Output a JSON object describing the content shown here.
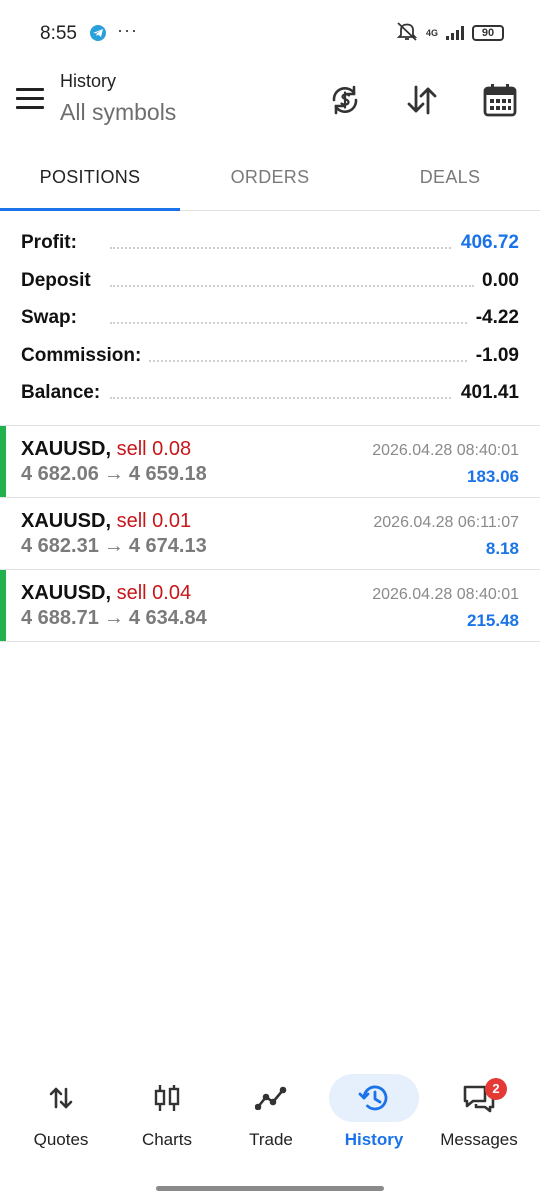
{
  "status_bar": {
    "time": "8:55",
    "dots": "···",
    "network": "4G",
    "battery": "90",
    "icons": [
      "telegram-icon",
      "mute-icon",
      "signal-icon",
      "battery-icon"
    ]
  },
  "header": {
    "title": "History",
    "subtitle": "All symbols",
    "icons": [
      "menu-icon",
      "currency-exchange-icon",
      "sort-icon",
      "calendar-icon"
    ]
  },
  "tabs": [
    {
      "label": "POSITIONS",
      "active": true
    },
    {
      "label": "ORDERS",
      "active": false
    },
    {
      "label": "DEALS",
      "active": false
    }
  ],
  "summary": [
    {
      "label": "Profit:",
      "value": "406.72",
      "color": "#1a73e8"
    },
    {
      "label": "Deposit",
      "value": "0.00",
      "color": "#111111"
    },
    {
      "label": "Swap:",
      "value": "-4.22",
      "color": "#111111"
    },
    {
      "label": "Commission:",
      "value": "-1.09",
      "color": "#111111"
    },
    {
      "label": "Balance:",
      "value": "401.41",
      "color": "#111111"
    }
  ],
  "trades": [
    {
      "symbol": "XAUUSD,",
      "side": "sell 0.08",
      "open": "4 682.06",
      "arrow": "→",
      "close": "4 659.18",
      "time": "2026.04.28 08:40:01",
      "profit": "183.06",
      "marker": true
    },
    {
      "symbol": "XAUUSD,",
      "side": "sell 0.01",
      "open": "4 682.31",
      "arrow": "→",
      "close": "4 674.13",
      "time": "2026.04.28 06:11:07",
      "profit": "8.18",
      "marker": false
    },
    {
      "symbol": "XAUUSD,",
      "side": "sell 0.04",
      "open": "4 688.71",
      "arrow": "→",
      "close": "4 634.84",
      "time": "2026.04.28 08:40:01",
      "profit": "215.48",
      "marker": true
    }
  ],
  "bottom_nav": [
    {
      "label": "Quotes",
      "icon": "quotes-arrows-icon",
      "active": false
    },
    {
      "label": "Charts",
      "icon": "candlestick-chart-icon",
      "active": false
    },
    {
      "label": "Trade",
      "icon": "trade-line-icon",
      "active": false
    },
    {
      "label": "History",
      "icon": "history-icon",
      "active": true
    },
    {
      "label": "Messages",
      "icon": "messages-icon",
      "active": false,
      "badge": "2"
    }
  ],
  "colors": {
    "accent": "#1a73e8",
    "sell": "#c8171b",
    "marker": "#22b14c",
    "badge": "#e53935"
  }
}
